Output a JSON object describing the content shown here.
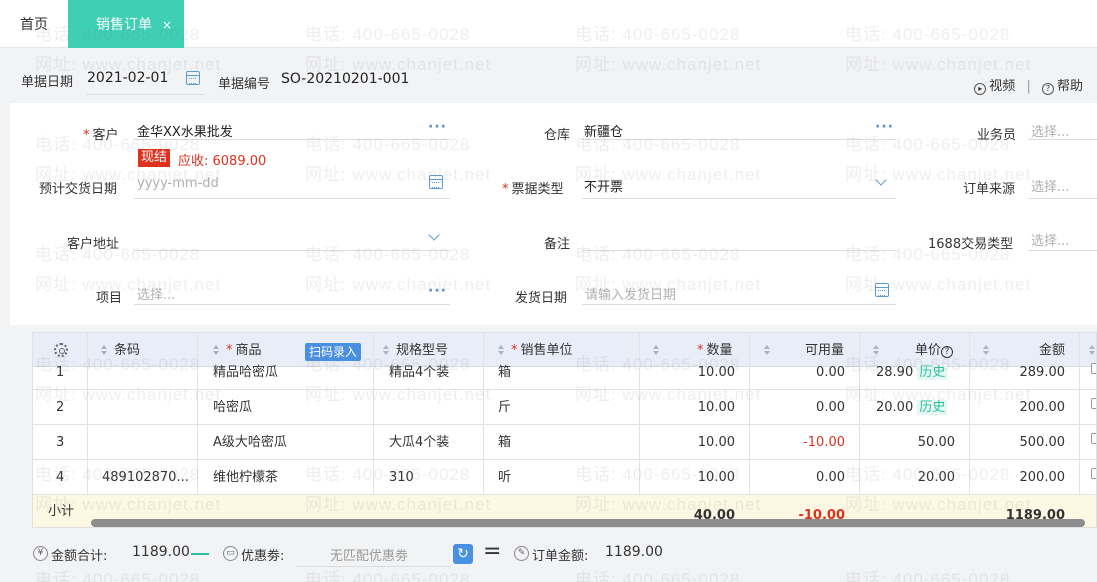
{
  "tabs": {
    "home": "首页",
    "active": "销售订单",
    "close": "×"
  },
  "header": {
    "date_label": "单据日期",
    "date_value": "2021-02-01",
    "code_label": "单据编号",
    "code_value": "SO-20210201-001",
    "video": "视频",
    "separator": "|",
    "help": "帮助"
  },
  "form": {
    "customer_label": "客户",
    "customer_value": "金华XX水果批发",
    "settle_badge": "现结",
    "receivable": "应收: 6089.00",
    "warehouse_label": "仓库",
    "warehouse_value": "新疆仓",
    "salesman_label": "业务员",
    "salesman_ph": "选择...",
    "delivery_label": "预计交货日期",
    "delivery_ph": "yyyy-mm-dd",
    "invoice_label": "票据类型",
    "invoice_value": "不开票",
    "source_label": "订单来源",
    "source_ph": "选择...",
    "address_label": "客户地址",
    "remark_label": "备注",
    "trade_label": "1688交易类型",
    "trade_ph": "选择...",
    "project_label": "项目",
    "project_ph": "选择...",
    "ship_label": "发货日期",
    "ship_ph": "请输入发货日期",
    "ellipsis": "···",
    "required_mark": "*"
  },
  "grid": {
    "headers": {
      "barcode": "条码",
      "product": "商品",
      "scan": "扫码录入",
      "spec": "规格型号",
      "unit": "销售单位",
      "qty": "数量",
      "avail": "可用量",
      "price": "单价",
      "price_help": "?",
      "amount": "金额"
    },
    "rows": [
      {
        "no": "1",
        "barcode": "",
        "product": "精品哈密瓜",
        "spec": "精品4个装",
        "unit": "箱",
        "qty": "10.00",
        "avail": "0.00",
        "price": "28.90",
        "hist": "历史",
        "amount": "289.00"
      },
      {
        "no": "2",
        "barcode": "",
        "product": "哈密瓜",
        "spec": "",
        "unit": "斤",
        "qty": "10.00",
        "avail": "0.00",
        "price": "20.00",
        "hist": "历史",
        "amount": "200.00"
      },
      {
        "no": "3",
        "barcode": "",
        "product": "A级大哈密瓜",
        "spec": "大瓜4个装",
        "unit": "箱",
        "qty": "10.00",
        "avail": "-10.00",
        "price": "50.00",
        "hist": "",
        "amount": "500.00"
      },
      {
        "no": "4",
        "barcode": "489102870...",
        "product": "维他柠檬茶",
        "spec": "310",
        "unit": "听",
        "qty": "10.00",
        "avail": "0.00",
        "price": "20.00",
        "hist": "",
        "amount": "200.00"
      }
    ],
    "subtotal": {
      "label": "小计",
      "qty": "40.00",
      "avail": "-10.00",
      "amount": "1189.00"
    }
  },
  "footer": {
    "total_label": "金额合计:",
    "total_value": "1189.00",
    "coupon_label": "优惠劵:",
    "coupon_value": "无匹配优惠劵",
    "order_label": "订单金额:",
    "order_value": "1189.00",
    "yen": "¥",
    "equals": "="
  },
  "watermark": {
    "phone": "电话: 400-665-0028",
    "site": "网址: www.chanjet.net"
  },
  "colors": {
    "accent": "#3ecfb5",
    "link": "#4a90e2",
    "error": "#e0301e"
  }
}
